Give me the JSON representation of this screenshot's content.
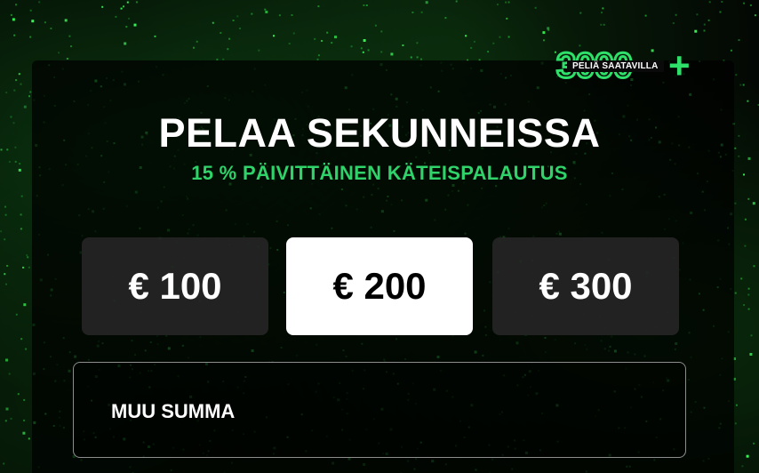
{
  "badge": {
    "number": "3000",
    "plus": "+",
    "label": "PELIÄ SAATAVILLA"
  },
  "hero": {
    "title": "PELAA SEKUNNEISSA",
    "subtitle": "15 % PÄIVITTÄINEN KÄTEISPALAUTUS"
  },
  "amounts": [
    {
      "label": "€ 100",
      "selected": false
    },
    {
      "label": "€ 200",
      "selected": true
    },
    {
      "label": "€ 300",
      "selected": false
    }
  ],
  "other_amount": {
    "placeholder": "MUU SUMMA"
  },
  "colors": {
    "accent_green": "#2fd36a",
    "selected_bg": "#ffffff",
    "option_bg": "#262626"
  }
}
